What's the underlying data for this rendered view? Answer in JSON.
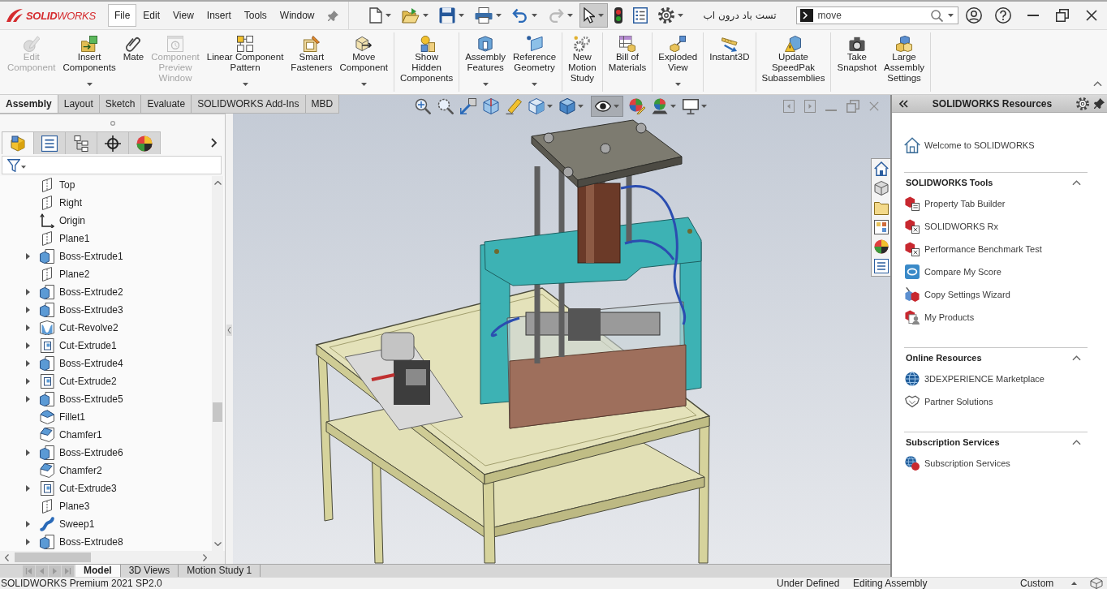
{
  "app": {
    "logo": "**SOLID**WORKS",
    "document_title": "تست باد درون اب"
  },
  "menu": [
    {
      "label": "File",
      "selected": true
    },
    {
      "label": "Edit",
      "selected": false
    },
    {
      "label": "View",
      "selected": false
    },
    {
      "label": "Insert",
      "selected": false
    },
    {
      "label": "Tools",
      "selected": false
    },
    {
      "label": "Window",
      "selected": false
    }
  ],
  "quick_access": [
    {
      "dropdown": true,
      "disabled": false,
      "pressed": false
    },
    {
      "dropdown": true,
      "disabled": false,
      "pressed": false
    },
    {
      "dropdown": true,
      "disabled": false,
      "pressed": false
    },
    {
      "dropdown": true,
      "disabled": false,
      "pressed": false
    },
    {
      "dropdown": true,
      "disabled": false,
      "pressed": false
    },
    {
      "dropdown": true,
      "disabled": true,
      "pressed": false
    },
    {
      "dropdown": true,
      "disabled": false,
      "pressed": true
    },
    {
      "dropdown": false,
      "disabled": false,
      "pressed": false
    },
    {
      "dropdown": false,
      "disabled": false,
      "pressed": false
    },
    {
      "dropdown": true,
      "disabled": false,
      "pressed": false
    }
  ],
  "search": {
    "value": "move"
  },
  "command_manager": {
    "groups": [
      {
        "buttons": [
          {
            "label": "Edit\nComponent",
            "disabled": true,
            "dropdown": false
          },
          {
            "label": "Insert\nComponents",
            "disabled": false,
            "dropdown": true
          },
          {
            "label": "Mate",
            "disabled": false,
            "dropdown": false
          },
          {
            "label": "Component\nPreview\nWindow",
            "disabled": true,
            "dropdown": false
          },
          {
            "label": "Linear Component\nPattern",
            "disabled": false,
            "dropdown": true
          },
          {
            "label": "Smart\nFasteners",
            "disabled": false,
            "dropdown": false
          },
          {
            "label": "Move\nComponent",
            "disabled": false,
            "dropdown": true
          }
        ]
      },
      {
        "buttons": [
          {
            "label": "Show\nHidden\nComponents",
            "disabled": false,
            "dropdown": false
          }
        ]
      },
      {
        "buttons": [
          {
            "label": "Assembly\nFeatures",
            "disabled": false,
            "dropdown": true
          },
          {
            "label": "Reference\nGeometry",
            "disabled": false,
            "dropdown": true
          }
        ]
      },
      {
        "buttons": [
          {
            "label": "New\nMotion\nStudy",
            "disabled": false,
            "dropdown": false
          }
        ]
      },
      {
        "buttons": [
          {
            "label": "Bill of\nMaterials",
            "disabled": false,
            "dropdown": false
          }
        ]
      },
      {
        "buttons": [
          {
            "label": "Exploded\nView",
            "disabled": false,
            "dropdown": true
          }
        ]
      },
      {
        "buttons": [
          {
            "label": "Instant3D",
            "disabled": false,
            "dropdown": false
          }
        ]
      },
      {
        "buttons": [
          {
            "label": "Update\nSpeedPak\nSubassemblies",
            "disabled": false,
            "dropdown": false
          }
        ]
      },
      {
        "buttons": [
          {
            "label": "Take\nSnapshot",
            "disabled": false,
            "dropdown": false
          },
          {
            "label": "Large\nAssembly\nSettings",
            "disabled": false,
            "dropdown": false
          }
        ]
      }
    ]
  },
  "command_tabs": [
    {
      "label": "Assembly",
      "selected": true
    },
    {
      "label": "Layout",
      "selected": false
    },
    {
      "label": "Sketch",
      "selected": false
    },
    {
      "label": "Evaluate",
      "selected": false
    },
    {
      "label": "SOLIDWORKS Add-Ins",
      "selected": false
    },
    {
      "label": "MBD",
      "selected": false
    }
  ],
  "feature_manager": {
    "tabs": [
      {
        "selected": true
      },
      {
        "selected": false
      },
      {
        "selected": false
      },
      {
        "selected": false
      },
      {
        "selected": false
      }
    ],
    "tree": [
      {
        "label": "Top",
        "kind": "plane",
        "collapsed": false
      },
      {
        "label": "Right",
        "kind": "plane",
        "collapsed": false
      },
      {
        "label": "Origin",
        "kind": "origin",
        "collapsed": false
      },
      {
        "label": "Plane1",
        "kind": "plane",
        "collapsed": false
      },
      {
        "label": "Boss-Extrude1",
        "kind": "boss",
        "collapsed": true
      },
      {
        "label": "Plane2",
        "kind": "plane",
        "collapsed": false
      },
      {
        "label": "Boss-Extrude2",
        "kind": "boss",
        "collapsed": true
      },
      {
        "label": "Boss-Extrude3",
        "kind": "boss",
        "collapsed": true
      },
      {
        "label": "Cut-Revolve2",
        "kind": "cut-revolve",
        "collapsed": true
      },
      {
        "label": "Cut-Extrude1",
        "kind": "cut",
        "collapsed": true
      },
      {
        "label": "Boss-Extrude4",
        "kind": "boss",
        "collapsed": true
      },
      {
        "label": "Cut-Extrude2",
        "kind": "cut",
        "collapsed": true
      },
      {
        "label": "Boss-Extrude5",
        "kind": "boss",
        "collapsed": true
      },
      {
        "label": "Fillet1",
        "kind": "fillet",
        "collapsed": false
      },
      {
        "label": "Chamfer1",
        "kind": "chamfer",
        "collapsed": false
      },
      {
        "label": "Boss-Extrude6",
        "kind": "boss",
        "collapsed": true
      },
      {
        "label": "Chamfer2",
        "kind": "chamfer",
        "collapsed": false
      },
      {
        "label": "Cut-Extrude3",
        "kind": "cut",
        "collapsed": true
      },
      {
        "label": "Plane3",
        "kind": "plane",
        "collapsed": false
      },
      {
        "label": "Sweep1",
        "kind": "sweep",
        "collapsed": true
      },
      {
        "label": "Boss-Extrude8",
        "kind": "boss",
        "collapsed": true
      }
    ]
  },
  "view_toolbar": [
    {
      "dropdown": false,
      "pressed": false
    },
    {
      "dropdown": false,
      "pressed": false
    },
    {
      "dropdown": false,
      "pressed": false
    },
    {
      "dropdown": false,
      "pressed": false
    },
    {
      "dropdown": false,
      "pressed": false
    },
    {
      "dropdown": true,
      "pressed": false
    },
    {
      "dropdown": true,
      "pressed": false
    },
    {
      "dropdown": true,
      "pressed": true
    },
    {
      "dropdown": false,
      "pressed": false
    },
    {
      "dropdown": true,
      "pressed": false
    },
    {
      "dropdown": true,
      "pressed": false
    }
  ],
  "bottom_tabs": [
    {
      "label": "Model",
      "selected": true
    },
    {
      "label": "3D Views",
      "selected": false
    },
    {
      "label": "Motion Study 1",
      "selected": false
    }
  ],
  "task_pane": {
    "title": "SOLIDWORKS Resources",
    "welcome": "Welcome to SOLIDWORKS",
    "sections": [
      {
        "title": "SOLIDWORKS Tools",
        "expanded": true,
        "items": [
          "Property Tab Builder",
          "SOLIDWORKS Rx",
          "Performance Benchmark Test",
          "Compare My Score",
          "Copy Settings Wizard",
          "My Products"
        ]
      },
      {
        "title": "Online Resources",
        "expanded": true,
        "items": [
          "3DEXPERIENCE Marketplace",
          "Partner Solutions"
        ]
      },
      {
        "title": "Subscription Services",
        "expanded": true,
        "items": [
          "Subscription Services"
        ]
      }
    ]
  },
  "status_bar": {
    "product": "SOLIDWORKS Premium 2021 SP2.0",
    "definition": "Under Defined",
    "mode": "Editing Assembly",
    "units": "Custom"
  }
}
